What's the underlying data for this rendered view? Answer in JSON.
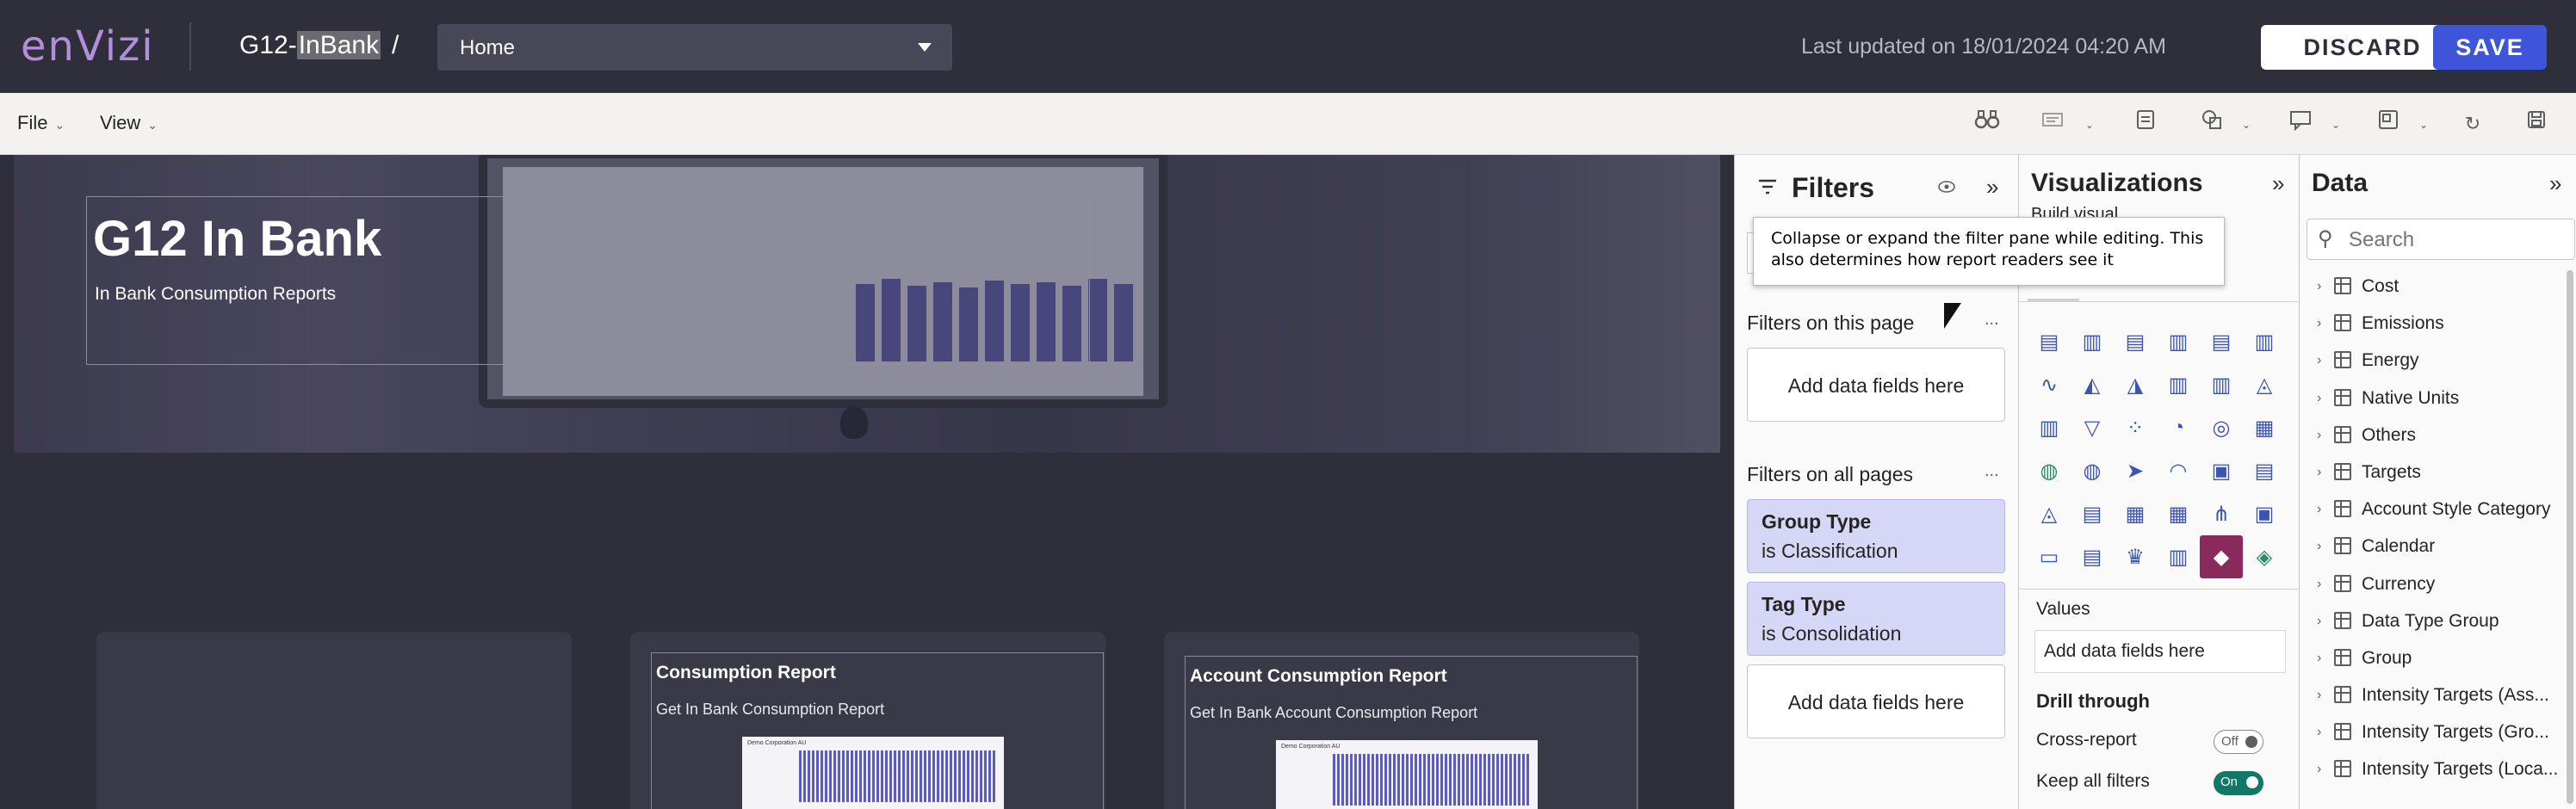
{
  "app": {
    "logo": "enVizi",
    "report_name_prefix": "G12-",
    "report_name_highlight": "InBank",
    "separator": "/",
    "page_selector": "Home",
    "last_updated": "Last updated on 18/01/2024 04:20 AM",
    "discard_label": "DISCARD",
    "save_label": "SAVE",
    "accent_color": "#3f55d9",
    "brand_color": "#b48fd9"
  },
  "ribbon": {
    "menus": [
      "File",
      "View"
    ],
    "icons": [
      "binoculars-icon",
      "text-box-icon",
      "comment-icon",
      "shapes-icon",
      "chat-icon",
      "visual-icon",
      "refresh-icon",
      "save-icon"
    ]
  },
  "canvas": {
    "title": "G12 In Bank",
    "subtitle": "In Bank Consumption Reports",
    "cards": [
      {
        "title": "",
        "desc": ""
      },
      {
        "title": "Consumption Report",
        "desc": "Get In Bank Consumption Report",
        "thumb_label": "Demo Corporation AU"
      },
      {
        "title": "Account Consumption Report",
        "desc": "Get In Bank Account Consumption Report",
        "thumb_label": "Demo Corporation AU"
      }
    ]
  },
  "filters": {
    "title": "Filters",
    "tooltip": "Collapse or expand the filter pane while editing. This also determines how report readers see it",
    "on_this_page": "Filters on this page",
    "on_all_pages": "Filters on all pages",
    "more": "...",
    "add_fields": "Add data fields here",
    "cards": [
      {
        "name": "Group Type",
        "value": "is Classification"
      },
      {
        "name": "Tag Type",
        "value": "is Consolidation"
      }
    ]
  },
  "visualizations": {
    "title": "Visualizations",
    "build_visual": "Build visual",
    "values_label": "Values",
    "add_fields": "Add data fields here",
    "drill_through": "Drill through",
    "cross_report": "Cross-report",
    "cross_report_state": "Off",
    "keep_all_filters": "Keep all filters",
    "keep_all_filters_state": "On",
    "icons": [
      "stacked-bar-icon",
      "stacked-column-icon",
      "clustered-bar-icon",
      "clustered-column-icon",
      "100-bar-icon",
      "100-column-icon",
      "line-chart-icon",
      "area-chart-icon",
      "stacked-area-icon",
      "line-column-icon",
      "line-clustered-icon",
      "ribbon-chart-icon",
      "waterfall-icon",
      "funnel-icon",
      "scatter-icon",
      "pie-chart-icon",
      "donut-chart-icon",
      "treemap-icon",
      "map-icon",
      "filled-map-icon",
      "azure-map-icon",
      "gauge-icon",
      "card-icon",
      "multi-row-card-icon",
      "kpi-icon",
      "slicer-icon",
      "table-icon",
      "matrix-icon",
      "decomposition-icon",
      "key-influencers-icon",
      "qa-icon",
      "paginated-icon",
      "trophy-icon",
      "report-icon",
      "power-apps-icon",
      "diamond-icon"
    ]
  },
  "data": {
    "title": "Data",
    "search_placeholder": "Search",
    "tables": [
      "Cost",
      "Emissions",
      "Energy",
      "Native Units",
      "Others",
      "Targets",
      "Account Style Category",
      "Calendar",
      "Currency",
      "Data Type Group",
      "Group",
      "Intensity Targets (Ass...",
      "Intensity Targets (Gro...",
      "Intensity Targets (Loca..."
    ]
  }
}
